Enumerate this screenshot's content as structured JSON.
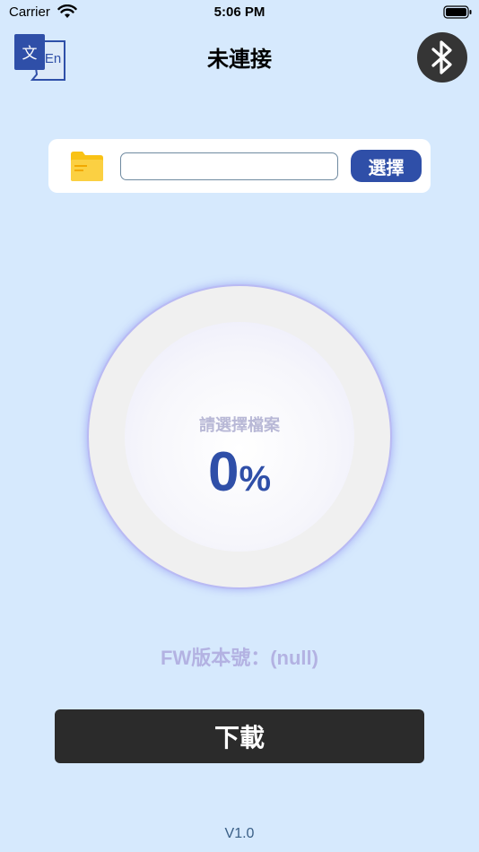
{
  "status_bar": {
    "carrier": "Carrier",
    "time": "5:06 PM",
    "icons": [
      "wifi-icon",
      "battery-icon"
    ]
  },
  "nav": {
    "title": "未連接",
    "translate_icon": {
      "name": "translate-icon",
      "glyph_left": "文",
      "glyph_right": "En"
    },
    "bluetooth_icon": "bluetooth-icon"
  },
  "file_picker": {
    "folder_icon": "folder-icon",
    "input_value": "",
    "select_label": "選擇"
  },
  "progress": {
    "status_text": "請選擇檔案",
    "value": "0",
    "unit": "%"
  },
  "fw_version": "FW版本號：(null)",
  "download_label": "下載",
  "app_version": "V1.0",
  "colors": {
    "background": "#d6e9fd",
    "accent": "#2f4fa8",
    "button_dark": "#2b2b2b",
    "bluetooth_bg": "#353535",
    "folder": "#f9c215"
  }
}
